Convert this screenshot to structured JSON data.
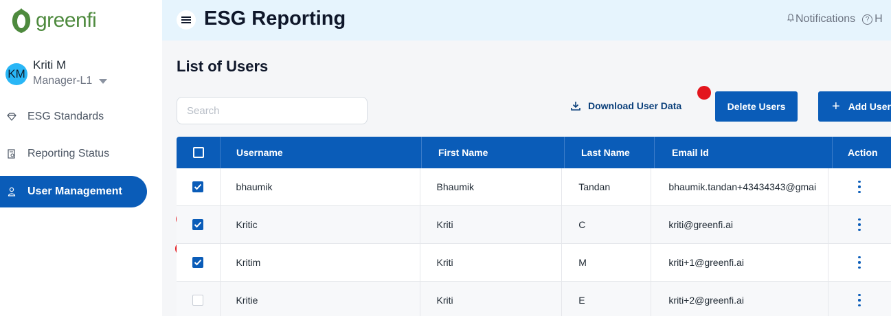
{
  "app": {
    "logo_text": "greenfi",
    "brand_color": "#4e8a3e",
    "accent_color": "#0a5cb8"
  },
  "user": {
    "initials": "KM",
    "name": "Kriti M",
    "role": "Manager-L1"
  },
  "sidebar": {
    "items": [
      {
        "label": "ESG Standards",
        "icon": "diamond-icon"
      },
      {
        "label": "Reporting Status",
        "icon": "report-icon"
      },
      {
        "label": "User Management",
        "icon": "user-icon",
        "active": true
      }
    ]
  },
  "header": {
    "title": "ESG Reporting",
    "notifications": "Notifications",
    "help_partial": "H"
  },
  "main": {
    "title": "List of Users",
    "search_placeholder": "Search",
    "download_label": "Download User Data",
    "delete_label": "Delete Users",
    "add_label": "Add User"
  },
  "table": {
    "columns": [
      "Username",
      "First Name",
      "Last Name",
      "Email Id",
      "Action"
    ],
    "rows": [
      {
        "username": "bhaumik",
        "first": "Bhaumik",
        "last": "Tandan",
        "email": "bhaumik.tandan+43434343@gmai",
        "checked": true
      },
      {
        "username": "Kritic",
        "first": "Kriti",
        "last": "C",
        "email": "kriti@greenfi.ai",
        "checked": true
      },
      {
        "username": "Kritim",
        "first": "Kriti",
        "last": "M",
        "email": "kriti+1@greenfi.ai",
        "checked": true
      },
      {
        "username": "Kritie",
        "first": "Kriti",
        "last": "E",
        "email": "kriti+2@greenfi.ai",
        "checked": false
      }
    ]
  }
}
